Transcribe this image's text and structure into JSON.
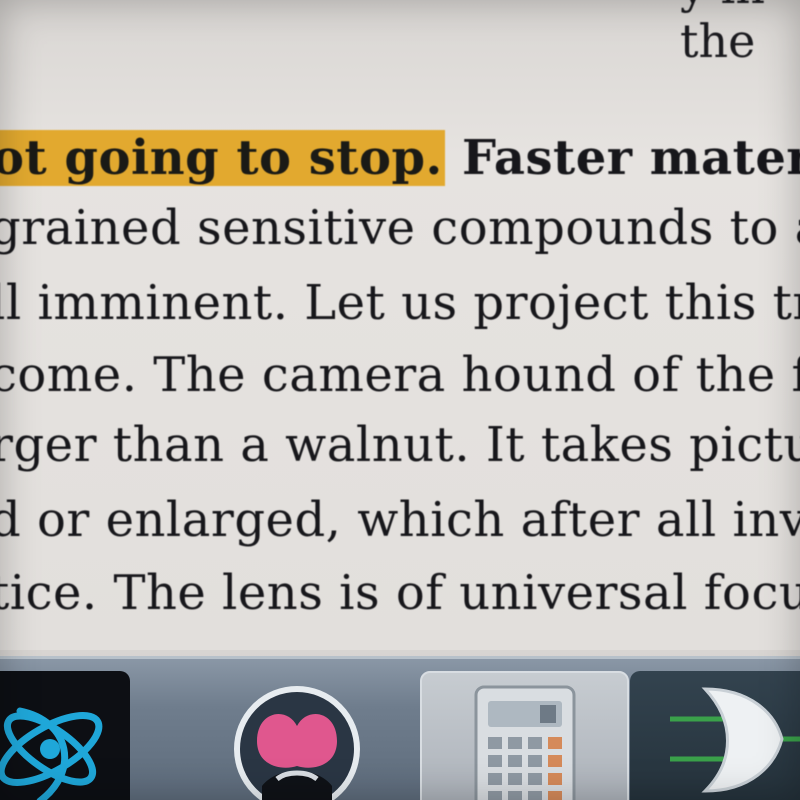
{
  "document": {
    "top_fragment": "y in the",
    "lines": [
      {
        "highlight": "ot going to stop.",
        "text": " Faster material and"
      },
      {
        "text": "grained sensitive compounds to allo"
      },
      {
        "text": "ll imminent. Let us project this tren"
      },
      {
        "text": "come. The camera hound of the futu"
      },
      {
        "text": "rger than a walnut. It takes pictures"
      },
      {
        "text": "d or enlarged, which after all involve"
      },
      {
        "text": "tice. The lens is of universal focus, d"
      }
    ]
  },
  "taskbar": {
    "items": [
      {
        "name": "app-swirl",
        "icon": "swirl-logo-icon"
      },
      {
        "name": "app-avatar",
        "icon": "pink-avatar-icon"
      },
      {
        "name": "app-calculator",
        "icon": "calculator-icon"
      },
      {
        "name": "app-logic-gate",
        "icon": "or-gate-icon"
      }
    ]
  },
  "colors": {
    "highlight": "#e2a92f",
    "text": "#17171b",
    "taskbar": "#6f7d8d"
  }
}
